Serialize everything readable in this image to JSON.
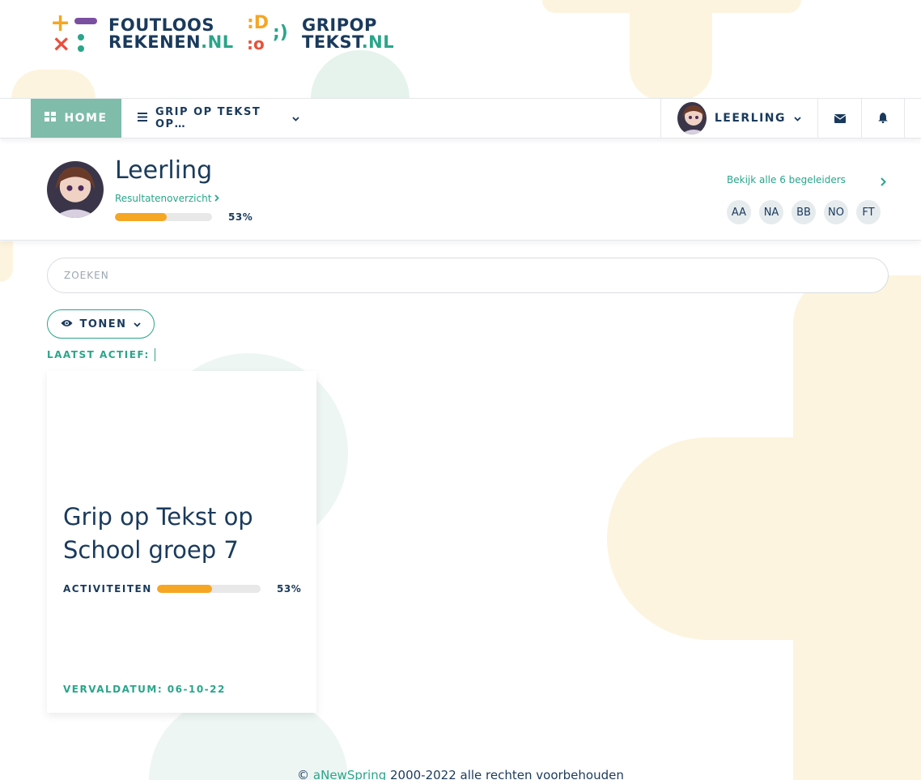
{
  "logos": {
    "foutloos": {
      "line1": "FOUTLOOS",
      "line2": "REKENEN",
      "suffix": ".NL"
    },
    "gripop": {
      "line1": "GRIPOP",
      "line2": "TEKST",
      "suffix": ".NL"
    }
  },
  "nav": {
    "home_label": "HOME",
    "course_label": "GRIP OP TEKST OP…",
    "user_label": "LEERLING",
    "icons": [
      "grid-icon",
      "bars-icon",
      "chevron-down-icon",
      "envelope-icon",
      "bell-icon"
    ]
  },
  "profile": {
    "name": "Leerling",
    "results_link": "Resultatenoverzicht",
    "progress_percent": 53,
    "progress_text": "53%",
    "guides_link": "Bekijk alle 6 begeleiders",
    "guides": [
      "AA",
      "NA",
      "BB",
      "NO",
      "FT"
    ]
  },
  "search": {
    "placeholder": "ZOEKEN"
  },
  "filter": {
    "label": "TONEN"
  },
  "last_active": {
    "label": "LAATST ACTIEF:"
  },
  "card": {
    "title": "Grip op Tekst op School groep 7",
    "activities_label": "ACTIVITEITEN",
    "progress_percent": 53,
    "progress_text": "53%",
    "due_label": "VERVALDATUM: 06-10-22"
  },
  "footer": {
    "prefix": "© ",
    "link": "aNewSpring",
    "suffix": " 2000-2022 alle rechten voorbehouden"
  },
  "colors": {
    "accent": "#2aa58a",
    "home_bg": "#7fbcaa",
    "progress": "#f5a623",
    "text": "#1a3a5c"
  }
}
